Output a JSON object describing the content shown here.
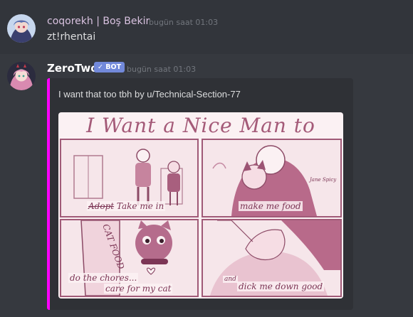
{
  "messages": [
    {
      "author": "coqorekh | Boş Bekir",
      "timestamp": "bugün saat 01:03",
      "content": "zt!rhentai"
    },
    {
      "author": "ZeroTwo",
      "badge": "✓ BOT",
      "timestamp": "bugün saat 01:03",
      "embed": {
        "accent_color": "#ff00ff",
        "description": "I want that too tbh by u/Technical-Section-77",
        "image": {
          "title": "I Want a Nice Man to",
          "panels": [
            {
              "caption_struck": "Adopt",
              "caption": "Take me in"
            },
            {
              "caption": "make me food",
              "signature": "Jane Spicy"
            },
            {
              "caption_line1": "do the chores...",
              "caption_line2": "care for my cat",
              "box_text": "CAT FOOD"
            },
            {
              "caption_small": "and",
              "caption": "dick me down good"
            }
          ]
        }
      }
    }
  ]
}
